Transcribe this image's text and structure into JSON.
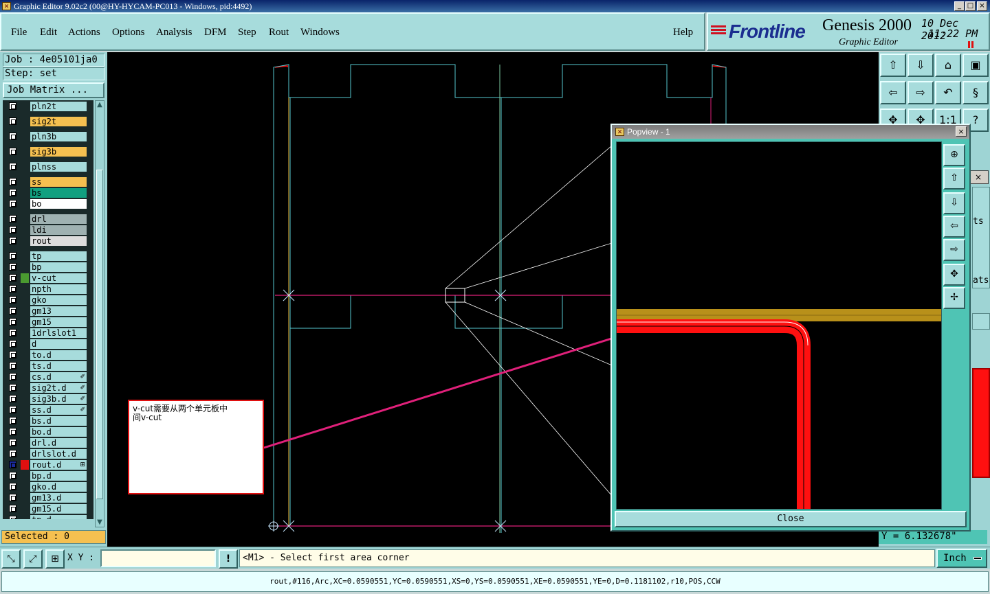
{
  "window": {
    "title": "Graphic Editor 9.02c2 (00@HY-HYCAM-PC013 - Windows, pid:4492)",
    "buttons": [
      "_",
      "□",
      "×"
    ]
  },
  "menu": {
    "items": [
      "File",
      "Edit",
      "Actions",
      "Options",
      "Analysis",
      "DFM",
      "Step",
      "Rout",
      "Windows"
    ],
    "help": "Help"
  },
  "brand": {
    "logo": "Frontline",
    "product": "Genesis 2000",
    "subtitle": "Graphic Editor",
    "date": "10 Dec 2012",
    "time": "11:22 PM"
  },
  "job": {
    "job_line": "Job : 4e05101ja0",
    "step_line": "Step: set",
    "matrix_button": "Job Matrix ..."
  },
  "layers": [
    {
      "name": "pln2t",
      "color": "#a7dcdc",
      "swatch": ""
    },
    {
      "name": "sig2t",
      "color": "#f5c050",
      "swatch": ""
    },
    {
      "name": "pln3b",
      "color": "#a7dcdc",
      "swatch": ""
    },
    {
      "name": "sig3b",
      "color": "#f5c050",
      "swatch": ""
    },
    {
      "name": "plnss",
      "color": "#a7dcdc",
      "swatch": ""
    },
    {
      "name": "ss",
      "color": "#f5c050",
      "swatch": ""
    },
    {
      "name": "bs",
      "color": "#11a080",
      "swatch": ""
    },
    {
      "name": "bo",
      "color": "#ffffff",
      "swatch": ""
    },
    {
      "name": "drl",
      "color": "#9fb2b2",
      "swatch": ""
    },
    {
      "name": "ldi",
      "color": "#9fb2b2",
      "swatch": ""
    },
    {
      "name": "rout",
      "color": "#dddddd",
      "swatch": ""
    },
    {
      "name": "tp",
      "color": "#a7dcdc",
      "swatch": ""
    },
    {
      "name": "bp",
      "color": "#a7dcdc",
      "swatch": ""
    },
    {
      "name": "v-cut",
      "color": "#a7dcdc",
      "swatch": "#4a9a30"
    },
    {
      "name": "npth",
      "color": "#a7dcdc",
      "swatch": ""
    },
    {
      "name": "gko",
      "color": "#a7dcdc",
      "swatch": ""
    },
    {
      "name": "gm13",
      "color": "#a7dcdc",
      "swatch": ""
    },
    {
      "name": "gm15",
      "color": "#a7dcdc",
      "swatch": ""
    },
    {
      "name": "1drlslot1",
      "color": "#a7dcdc",
      "swatch": ""
    },
    {
      "name": "d",
      "color": "#a7dcdc",
      "swatch": ""
    },
    {
      "name": "to.d",
      "color": "#a7dcdc",
      "swatch": ""
    },
    {
      "name": "ts.d",
      "color": "#a7dcdc",
      "swatch": ""
    },
    {
      "name": "cs.d",
      "color": "#a7dcdc",
      "swatch": "",
      "mark": "✐"
    },
    {
      "name": "sig2t.d",
      "color": "#a7dcdc",
      "swatch": "",
      "mark": "✐"
    },
    {
      "name": "sig3b.d",
      "color": "#a7dcdc",
      "swatch": "",
      "mark": "✐"
    },
    {
      "name": "ss.d",
      "color": "#a7dcdc",
      "swatch": "",
      "mark": "✐"
    },
    {
      "name": "bs.d",
      "color": "#a7dcdc",
      "swatch": ""
    },
    {
      "name": "bo.d",
      "color": "#a7dcdc",
      "swatch": ""
    },
    {
      "name": "drl.d",
      "color": "#a7dcdc",
      "swatch": ""
    },
    {
      "name": "drlslot.d",
      "color": "#a7dcdc",
      "swatch": ""
    },
    {
      "name": "rout.d",
      "color": "#a7dcdc",
      "swatch": "#e01010",
      "mark": "⊞",
      "active": true
    },
    {
      "name": "bp.d",
      "color": "#a7dcdc",
      "swatch": ""
    },
    {
      "name": "gko.d",
      "color": "#a7dcdc",
      "swatch": ""
    },
    {
      "name": "gm13.d",
      "color": "#a7dcdc",
      "swatch": ""
    },
    {
      "name": "gm15.d",
      "color": "#a7dcdc",
      "swatch": ""
    },
    {
      "name": "tp.d",
      "color": "#a7dcdc",
      "swatch": ""
    }
  ],
  "selected": "Selected : 0",
  "popview": {
    "title": "Popview - 1",
    "close_label": "Close"
  },
  "annotation": {
    "line1": "v-cut需要从两个单元板中",
    "line2": "间v-cut"
  },
  "right_fragments": {
    "frag1": "ts",
    "frag2": "ats"
  },
  "coords": {
    "y_readout": "Y = 6.132678\""
  },
  "bottom": {
    "xy_label": "X Y :",
    "xy_value": "",
    "prompt": "<M1> - Select first area corner",
    "unit": "Inch",
    "bang": "!"
  },
  "status": "rout,#116,Arc,XC=0.0590551,YC=0.0590551,XS=0,YS=0.0590551,XE=0.0590551,YE=0,D=0.1181102,r10,POS,CCW",
  "colors": {
    "panel": "#a7dcdc",
    "canvas": "#000000",
    "outline_cyan": "#56c8d0",
    "profile_magenta": "#e0207a",
    "rout_red": "#ff1010",
    "vcut_green": "#7cc8a0",
    "copper_gold": "#b8901a"
  }
}
